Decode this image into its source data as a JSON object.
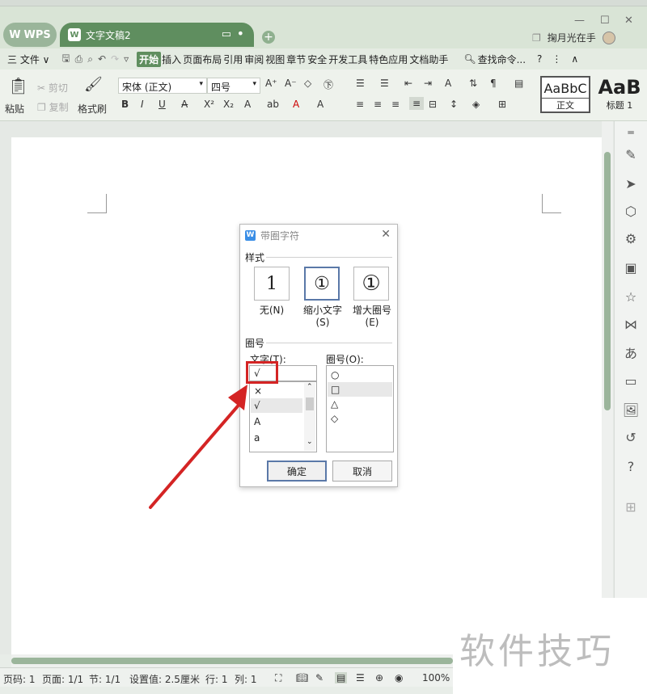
{
  "titlebar": {
    "app_tab_label": "WPS",
    "doc_tab_label": "文字文稿2",
    "user_name": "掬月光在手"
  },
  "menubar": {
    "items": [
      {
        "label": "三 文件 ∨"
      },
      {
        "label": "开始",
        "active": true
      },
      {
        "label": "插入"
      },
      {
        "label": "页面布局"
      },
      {
        "label": "引用"
      },
      {
        "label": "审阅"
      },
      {
        "label": "视图"
      },
      {
        "label": "章节"
      },
      {
        "label": "安全"
      },
      {
        "label": "开发工具"
      },
      {
        "label": "特色应用"
      },
      {
        "label": "文档助手"
      }
    ],
    "search_label": "查找命令..."
  },
  "ribbon": {
    "paste_label": "粘贴",
    "cut_label": "剪切",
    "copy_label": "复制",
    "format_painter_label": "格式刷",
    "font_name": "宋体 (正文)",
    "font_size": "四号",
    "style_normal_preview": "AaBbC",
    "style_normal_label": "正文",
    "style_h1_preview": "AaB",
    "style_h1_label": "标题 1"
  },
  "dialog": {
    "title": "带圈字符",
    "style_group_label": "样式",
    "style_options": [
      {
        "label": "无(N)",
        "glyph": "1"
      },
      {
        "label": "缩小文字\n(S)",
        "glyph": "①"
      },
      {
        "label": "增大圈号\n(E)",
        "glyph": "①"
      }
    ],
    "enclosure_group_label": "圈号",
    "text_label": "文字(T):",
    "text_value": "√",
    "text_list": [
      "×",
      "√",
      "A",
      "a"
    ],
    "enclosure_label": "圈号(O):",
    "enclosure_list": [
      "○",
      "□",
      "△",
      "◇"
    ],
    "ok_label": "确定",
    "cancel_label": "取消"
  },
  "statusbar": {
    "page_num": "页码: 1",
    "page_count": "页面: 1/1",
    "section": "节: 1/1",
    "setting": "设置值: 2.5厘米",
    "row": "行: 1",
    "col": "列: 1",
    "zoom": "100%"
  },
  "watermark": {
    "text": "软件技巧"
  },
  "colors": {
    "accent": "#5f8e5f",
    "highlight": "#d42424"
  }
}
